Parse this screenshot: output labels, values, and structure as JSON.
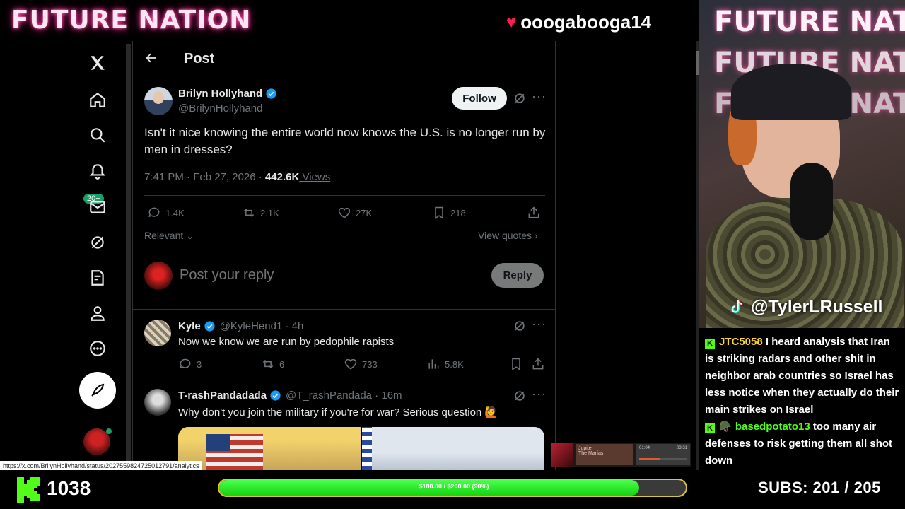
{
  "overlay": {
    "title": "FUTURE NATION",
    "viewer": "ooogabooga14"
  },
  "nav": {
    "notif_badge": "20+"
  },
  "header": {
    "title": "Post"
  },
  "tweet": {
    "author_name": "Brilyn Hollyhand",
    "author_handle": "@BrilynHollyhand",
    "follow_label": "Follow",
    "text": "Isn't it nice knowing the entire world now knows the U.S. is no longer run by men in dresses?",
    "time": "7:41 PM · Feb 27, 2026 · ",
    "views_count": "442.6K",
    "views_label": " Views",
    "replies": "1.4K",
    "reposts": "2.1K",
    "likes": "27K",
    "bookmarks": "218",
    "sort_label": "Relevant",
    "view_quotes": "View quotes"
  },
  "reply_box": {
    "placeholder": "Post your reply",
    "button": "Reply"
  },
  "comments": [
    {
      "name": "Kyle",
      "handle": "@KyleHend1 · 4h",
      "text": "Now we know we are run by pedophile rapists",
      "replies": "3",
      "reposts": "6",
      "likes": "733",
      "views": "5.8K"
    },
    {
      "name": "T-rashPandadada",
      "handle": "@T_rashPandada · 16m",
      "text": "Why don't you join the military if you're for war? Serious question 🙋"
    }
  ],
  "status_url": "https://x.com/BrilynHollyhand/status/2027559824725012791/analytics",
  "cam": {
    "bg_text": "FUTURE NATION",
    "tiktok_handle": "@TylerLRussell"
  },
  "chat": [
    {
      "user": "JTC5058",
      "message": "I heard analysis that Iran is striking radars and other shit in neighbor arab countries so Israel has less notice when they actually do their main strikes on Israel"
    },
    {
      "user": "🪖 basedpotato13",
      "message": "too many air defenses to risk getting them all shot down"
    }
  ],
  "mini_player": {
    "title": "Jupiter",
    "artist": "The Marías",
    "elapsed": "01:04",
    "remaining": "03:31",
    "progress": 0.42
  },
  "bottom": {
    "kick_count": "1038",
    "goal_text": "$180.00 / $200.00 (90%)",
    "goal_progress": 0.9,
    "subs_text": "SUBS:  201 / 205"
  },
  "colors": {
    "accent_blue": "#1d9bf0",
    "kick_green": "#53fc18",
    "chat_user_yellow": "#fcd535",
    "goal_border": "#d9c531"
  }
}
